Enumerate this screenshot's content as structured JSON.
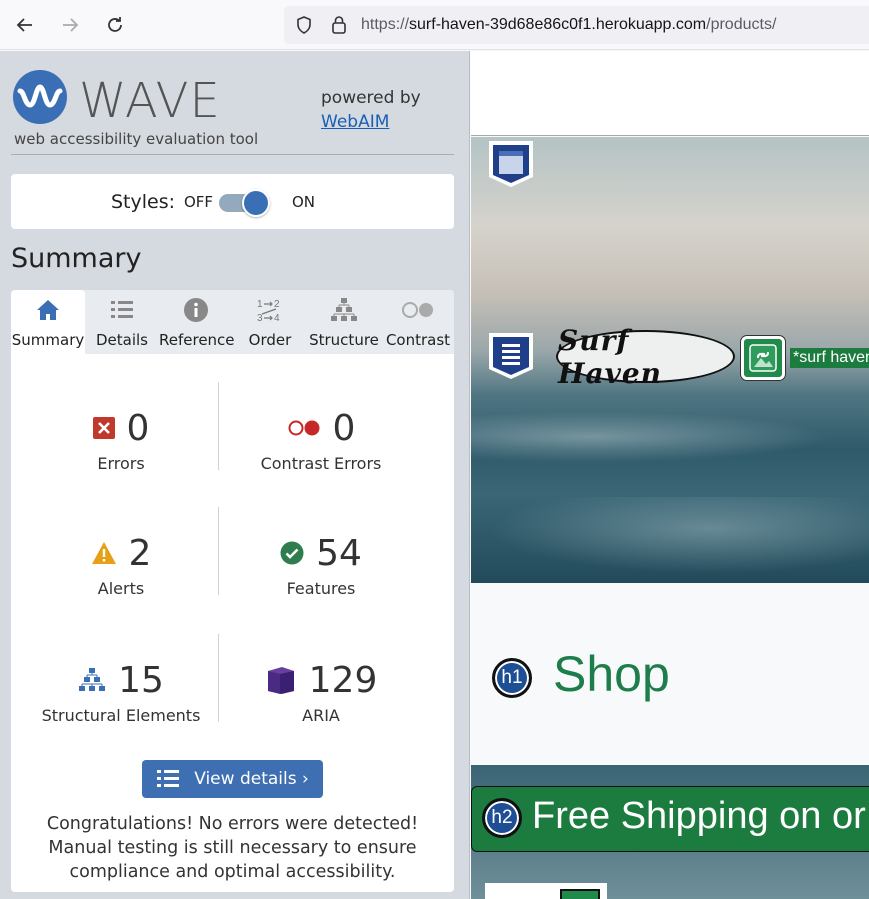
{
  "browser": {
    "url_prefix": "https://",
    "url_host": "surf-haven-39d68e86c0f1.herokuapp.com",
    "url_path": "/products/"
  },
  "wave": {
    "logo_word": "WAVE",
    "tagline": "web accessibility evaluation tool",
    "powered_by": "powered by",
    "webaim_link": "WebAIM",
    "styles": {
      "label": "Styles:",
      "off": "OFF",
      "on": "ON",
      "state": "on"
    },
    "summary_title": "Summary",
    "tabs": [
      {
        "label": "Summary",
        "icon": "home-icon",
        "active": true
      },
      {
        "label": "Details",
        "icon": "list-icon",
        "active": false
      },
      {
        "label": "Reference",
        "icon": "info-icon",
        "active": false
      },
      {
        "label": "Order",
        "icon": "order-icon",
        "active": false
      },
      {
        "label": "Structure",
        "icon": "structure-icon",
        "active": false
      },
      {
        "label": "Contrast",
        "icon": "contrast-icon",
        "active": false
      }
    ],
    "stats": {
      "errors": {
        "value": "0",
        "label": "Errors",
        "color": "#c0392b"
      },
      "contrast_errors": {
        "value": "0",
        "label": "Contrast Errors",
        "color": "#c62828"
      },
      "alerts": {
        "value": "2",
        "label": "Alerts",
        "color": "#e6a117"
      },
      "features": {
        "value": "54",
        "label": "Features",
        "color": "#2e7d4f"
      },
      "structural": {
        "value": "15",
        "label": "Structural Elements",
        "color": "#3b6fb5"
      },
      "aria": {
        "value": "129",
        "label": "ARIA",
        "color": "#4b2a84"
      }
    },
    "view_details": "View details ›",
    "congrats": "Congratulations! No errors were detected! Manual testing is still necessary to ensure compliance and optimal accessibility."
  },
  "site": {
    "logo_text": "Surf Haven",
    "alt_text": "*surf haven",
    "h1_badge": "h1",
    "shop_heading": "Shop",
    "h2_badge": "h2",
    "shipping_text": "Free Shipping on or"
  }
}
